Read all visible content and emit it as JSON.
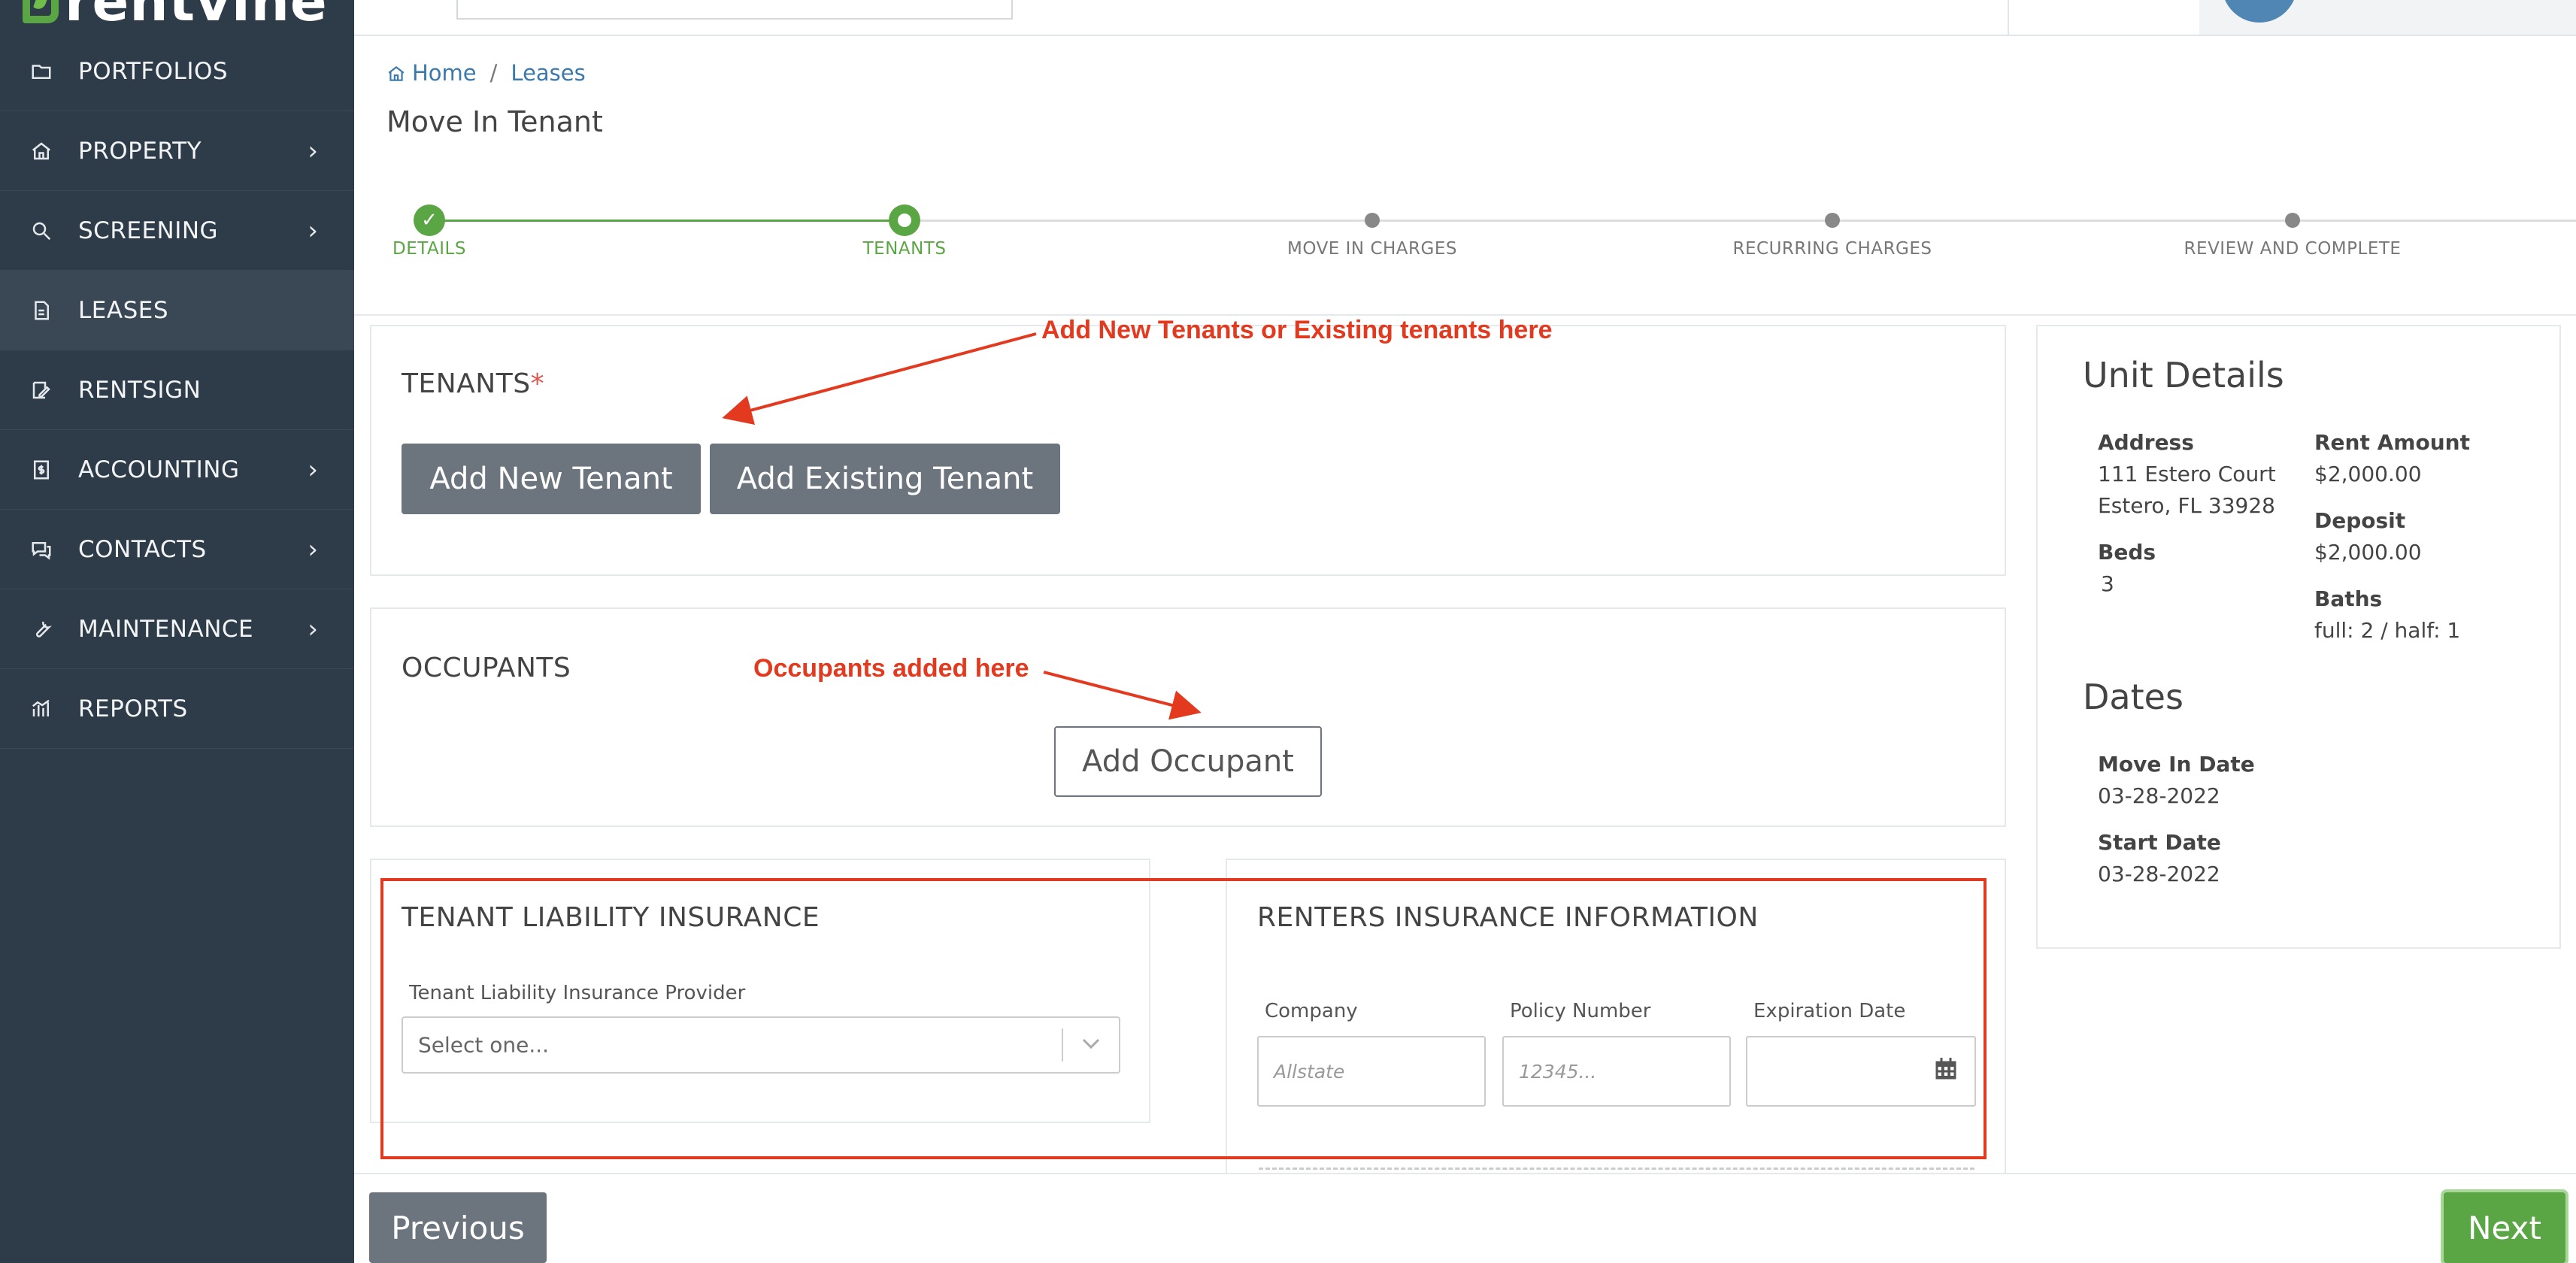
{
  "brand": {
    "name": "rentvine"
  },
  "sidebar": {
    "items": [
      {
        "label": "PORTFOLIOS",
        "icon": "folder-icon",
        "has_chevron": false
      },
      {
        "label": "PROPERTY",
        "icon": "house-icon",
        "has_chevron": true
      },
      {
        "label": "SCREENING",
        "icon": "magnifier-icon",
        "has_chevron": true
      },
      {
        "label": "LEASES",
        "icon": "document-icon",
        "has_chevron": false,
        "active": true
      },
      {
        "label": "RENTSIGN",
        "icon": "signature-icon",
        "has_chevron": false
      },
      {
        "label": "ACCOUNTING",
        "icon": "dollar-file-icon",
        "has_chevron": true
      },
      {
        "label": "CONTACTS",
        "icon": "chat-icon",
        "has_chevron": true
      },
      {
        "label": "MAINTENANCE",
        "icon": "wrench-icon",
        "has_chevron": true
      },
      {
        "label": "REPORTS",
        "icon": "chart-icon",
        "has_chevron": false
      }
    ],
    "chevron": "›"
  },
  "breadcrumb": {
    "home": "Home",
    "separator": "/",
    "current": "Leases"
  },
  "page": {
    "title": "Move In Tenant"
  },
  "stepper": {
    "steps": [
      {
        "label": "DETAILS",
        "state": "done"
      },
      {
        "label": "TENANTS",
        "state": "current"
      },
      {
        "label": "MOVE IN CHARGES",
        "state": "todo"
      },
      {
        "label": "RECURRING CHARGES",
        "state": "todo"
      },
      {
        "label": "REVIEW AND COMPLETE",
        "state": "todo"
      }
    ],
    "done_mark": "✓"
  },
  "tenants": {
    "title": "TENANTS",
    "required_mark": "*",
    "add_new_label": "Add New Tenant",
    "add_existing_label": "Add Existing Tenant"
  },
  "occupants": {
    "title": "OCCUPANTS",
    "add_label": "Add Occupant"
  },
  "liability": {
    "title": "TENANT LIABILITY INSURANCE",
    "provider_label": "Tenant Liability Insurance Provider",
    "provider_placeholder": "Select one..."
  },
  "renters": {
    "title": "RENTERS INSURANCE INFORMATION",
    "company_label": "Company",
    "company_placeholder": "Allstate",
    "policy_label": "Policy Number",
    "policy_placeholder": "12345...",
    "expiration_label": "Expiration Date"
  },
  "unit_details": {
    "title": "Unit Details",
    "address_label": "Address",
    "address_line1": "111 Estero Court",
    "address_line2": "Estero, FL 33928",
    "beds_label": "Beds",
    "beds_value": "3",
    "rent_label": "Rent Amount",
    "rent_value": "$2,000.00",
    "deposit_label": "Deposit",
    "deposit_value": "$2,000.00",
    "baths_label": "Baths",
    "baths_value": "full: 2 / half: 1"
  },
  "dates": {
    "title": "Dates",
    "move_in_label": "Move In Date",
    "move_in_value": "03-28-2022",
    "start_label": "Start Date",
    "start_value": "03-28-2022"
  },
  "annotations": {
    "tenants_note": "Add New Tenants or Existing tenants here",
    "occupants_note": "Occupants added here",
    "color": "#e33a1f"
  },
  "footer": {
    "previous_label": "Previous",
    "next_label": "Next"
  },
  "colors": {
    "sidebar": "#2e3b48",
    "accent_green": "#5aa645",
    "button_gray": "#6c757d",
    "link_blue": "#3a79ad"
  }
}
